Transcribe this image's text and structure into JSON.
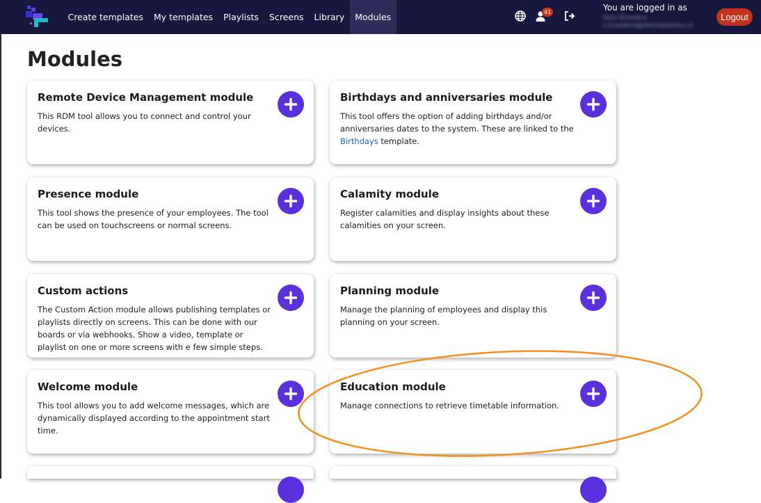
{
  "nav": {
    "items": [
      {
        "label": "Create templates"
      },
      {
        "label": "My templates"
      },
      {
        "label": "Playlists"
      },
      {
        "label": "Screens"
      },
      {
        "label": "Library"
      },
      {
        "label": "Modules",
        "active": true
      }
    ],
    "notification_count": "41",
    "logged_in_label": "You are logged in as",
    "user_name": "Sam Broeders",
    "user_email": "s.broeders@dienstpannen.nl",
    "logout_label": "Logout"
  },
  "page": {
    "title": "Modules"
  },
  "colors": {
    "topbar": "#16173d",
    "add_button": "#5a2fdc",
    "logout": "#c3321f",
    "annotation": "#ef9424",
    "link": "#1e63c9"
  },
  "icons": {
    "logo": "app-logo-icon",
    "language": "globe-icon",
    "user": "user-icon",
    "exit": "sign-out-icon",
    "add": "plus-icon"
  },
  "modules": [
    {
      "title": "Remote Device Management module",
      "desc": "This RDM tool allows you to connect and control your devices."
    },
    {
      "title": "Birthdays and anniversaries module",
      "desc_before": "This tool offers the option of adding birthdays and/or anniversaries dates to the system. These are linked to the ",
      "link": "Birthdays",
      "desc_after": " template."
    },
    {
      "title": "Presence module",
      "desc": "This tool shows the presence of your employees. The tool can be used on touchscreens or normal screens."
    },
    {
      "title": "Calamity module",
      "desc": "Register calamities and display insights about these calamities on your screen."
    },
    {
      "title": "Custom actions",
      "desc": "The Custom Action module allows publishing templates or playlists directly on screens. This can be done with our boards or via webhooks. Show a video, template or playlist on one or more screens with e few simple steps."
    },
    {
      "title": "Planning module",
      "desc": "Manage the planning of employees and display this planning on your screen."
    },
    {
      "title": "Welcome module",
      "desc": "This tool allows you to add welcome messages, which are dynamically displayed according to the appointment start time."
    },
    {
      "title": "Education module",
      "desc": "Manage connections to retrieve timetable information."
    },
    {
      "title": "",
      "desc": ""
    },
    {
      "title": "",
      "desc": ""
    }
  ]
}
